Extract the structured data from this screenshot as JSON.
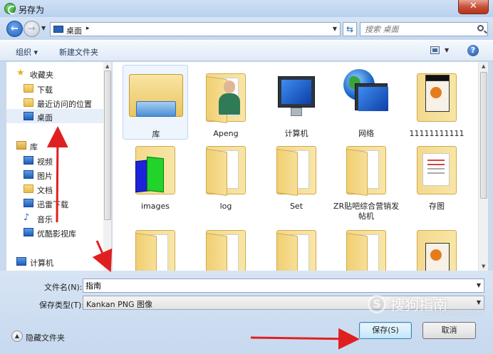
{
  "window": {
    "title": "另存为",
    "close_glyph": "✕"
  },
  "address": {
    "location": "桌面",
    "separator": "▸",
    "search_placeholder": "搜索 桌面"
  },
  "toolbar": {
    "organize": "组织 ▾",
    "new_folder": "新建文件夹",
    "help": "?"
  },
  "sidebar": {
    "items": [
      {
        "label": "收藏夹",
        "icon": "star-icon"
      },
      {
        "label": "下载",
        "icon": "download-folder-icon"
      },
      {
        "label": "最近访问的位置",
        "icon": "recent-places-icon"
      },
      {
        "label": "桌面",
        "icon": "desktop-icon",
        "selected": true
      },
      {
        "label": "库",
        "icon": "library-icon"
      },
      {
        "label": "视频",
        "icon": "video-library-icon"
      },
      {
        "label": "图片",
        "icon": "pictures-library-icon"
      },
      {
        "label": "文档",
        "icon": "documents-library-icon"
      },
      {
        "label": "迅雷下载",
        "icon": "thunder-download-icon"
      },
      {
        "label": "音乐",
        "icon": "music-library-icon"
      },
      {
        "label": "优酷影视库",
        "icon": "youku-library-icon"
      },
      {
        "label": "计算机",
        "icon": "computer-icon"
      }
    ]
  },
  "files": [
    {
      "label": "库",
      "kind": "library"
    },
    {
      "label": "Apeng",
      "kind": "user"
    },
    {
      "label": "计算机",
      "kind": "computer"
    },
    {
      "label": "网络",
      "kind": "network"
    },
    {
      "label": "11111111111",
      "kind": "ppt-folder"
    },
    {
      "label": "images",
      "kind": "color-folder"
    },
    {
      "label": "log",
      "kind": "folder"
    },
    {
      "label": "Set",
      "kind": "folder"
    },
    {
      "label": "ZR贴吧综合营销发帖机",
      "kind": "folder"
    },
    {
      "label": "存图",
      "kind": "doc-folder"
    },
    {
      "label": "",
      "kind": "folder"
    },
    {
      "label": "",
      "kind": "folder"
    },
    {
      "label": "",
      "kind": "folder"
    },
    {
      "label": "",
      "kind": "folder"
    },
    {
      "label": "",
      "kind": "ppt-folder"
    }
  ],
  "form": {
    "filename_label": "文件名(N):",
    "filename_value": "指南",
    "filetype_label": "保存类型(T):",
    "filetype_value": "Kankan PNG 图像"
  },
  "footer": {
    "hide_folders": "隐藏文件夹",
    "save": "保存(S)",
    "cancel": "取消"
  },
  "watermark": {
    "mark": "S",
    "brand": "搜狗指南",
    "url": "zhinan.sogou.com"
  },
  "colors": {
    "annotation": "#e02020",
    "accent": "#3c7fb1"
  }
}
